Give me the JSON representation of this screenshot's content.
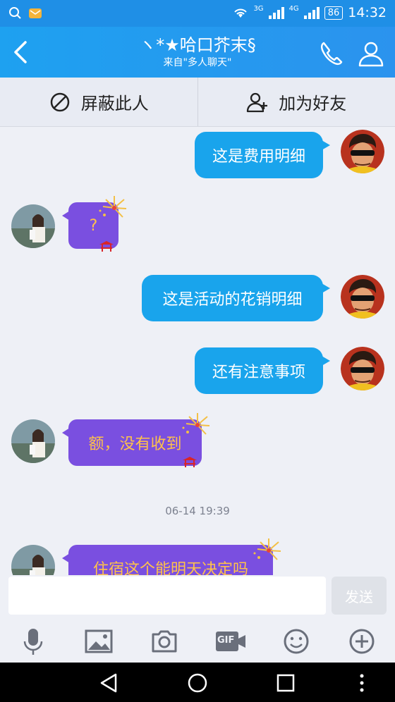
{
  "status_bar": {
    "network_3g": "3G",
    "network_4g": "4G",
    "battery": "86",
    "time": "14:32"
  },
  "header": {
    "title": "ヽ*★哈口芥末§",
    "subtitle": "来自\"多人聊天\""
  },
  "actions": {
    "block": "屏蔽此人",
    "add_friend": "加为好友"
  },
  "messages": [
    {
      "side": "right",
      "text": "这是费用明细"
    },
    {
      "side": "left",
      "text": "?"
    },
    {
      "side": "right",
      "text": "这是活动的花销明细"
    },
    {
      "side": "right",
      "text": "还有注意事项"
    },
    {
      "side": "left",
      "text": "额，没有收到"
    },
    {
      "side": "left",
      "text": "住宿这个能明天决定吗"
    }
  ],
  "timestamp": "06-14 19:39",
  "input": {
    "placeholder": "",
    "send_label": "发送"
  },
  "toolbar": {
    "gif_label": "GIF"
  },
  "colors": {
    "accent": "#1ea1f0",
    "sent_bubble": "#19a4ec",
    "received_bubble": "#7a4fe0",
    "received_text": "#ffc24a"
  }
}
